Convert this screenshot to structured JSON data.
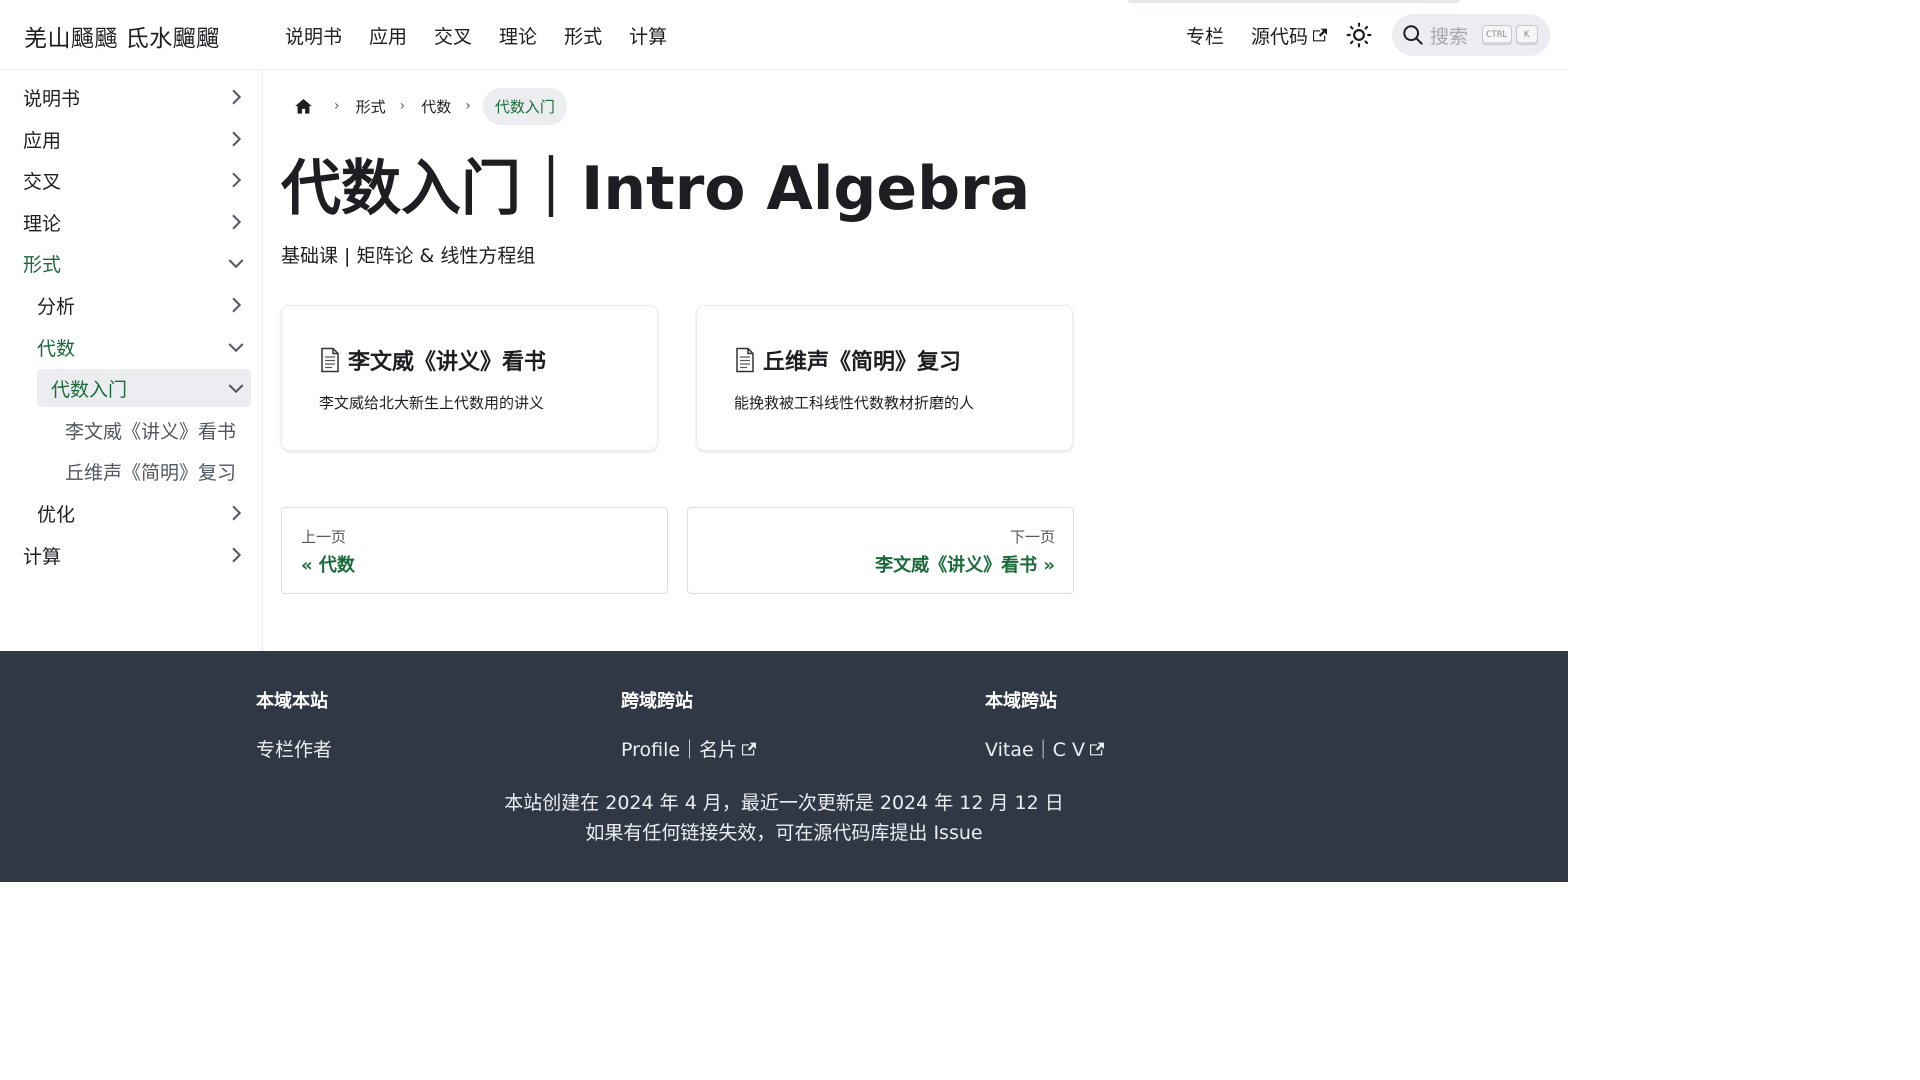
{
  "navbar": {
    "brand": "羌山颾颾 氐水飀飀",
    "links": [
      "说明书",
      "应用",
      "交叉",
      "理论",
      "形式",
      "计算"
    ],
    "right_links": {
      "column": "专栏",
      "source": "源代码"
    },
    "search": {
      "placeholder": "搜索",
      "kbd_ctrl": "CTRL",
      "kbd_k": "K"
    }
  },
  "sidebar": {
    "items": [
      {
        "label": "说明书"
      },
      {
        "label": "应用"
      },
      {
        "label": "交叉"
      },
      {
        "label": "理论"
      },
      {
        "label": "形式"
      },
      {
        "label": "分析"
      },
      {
        "label": "代数"
      },
      {
        "label": "代数入门"
      },
      {
        "label": "李文威《讲义》看书"
      },
      {
        "label": "丘维声《简明》复习"
      },
      {
        "label": "优化"
      },
      {
        "label": "计算"
      }
    ]
  },
  "breadcrumb": [
    "形式",
    "代数",
    "代数入门"
  ],
  "page": {
    "title": "代数入门｜Intro Algebra",
    "subtitle": "基础课 | 矩阵论 & 线性方程组"
  },
  "cards": [
    {
      "title": "李文威《讲义》看书",
      "desc": "李文威给北大新生上代数用的讲义"
    },
    {
      "title": "丘维声《简明》复习",
      "desc": "能挽救被工科线性代数教材折磨的人"
    }
  ],
  "pager": {
    "prev": {
      "sub": "上一页",
      "label": "« 代数"
    },
    "next": {
      "sub": "下一页",
      "label": "李文威《讲义》看书 »"
    }
  },
  "footer": {
    "columns": [
      {
        "title": "本域本站",
        "link": "专栏作者"
      },
      {
        "title": "跨域跨站",
        "link": "Profile｜名片"
      },
      {
        "title": "本域跨站",
        "link": "Vitae｜C V"
      }
    ],
    "copyright_line1": "本站创建在 2024 年 4 月，最近一次更新是 2024 年 12 月 12 日",
    "copyright_line2": "如果有任何链接失效，可在源代码库提出 Issue"
  },
  "colors": {
    "accent": "#1b6b3a",
    "footer_bg": "#303846",
    "selected_bg": "#ebedf0"
  }
}
